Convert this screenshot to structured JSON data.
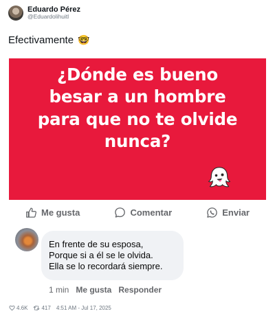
{
  "author": {
    "name": "Eduardo Pérez",
    "handle": "@Eduardolihuitl"
  },
  "tweet": {
    "text": "Efectivamente",
    "emoji": "🤓"
  },
  "post": {
    "lines": [
      "¿Dónde es bueno",
      "besar a un hombre",
      "para que no te olvide",
      "nunca?"
    ],
    "colors": {
      "background": "#e8193c",
      "text": "#ffffff"
    },
    "sticker": "ghost-sticker"
  },
  "actions": {
    "like": "Me gusta",
    "comment": "Comentar",
    "send": "Enviar"
  },
  "comment": {
    "lines": [
      "En frente de su esposa,",
      "Porque si a él se le olvida.",
      "Ella se lo recordará siempre."
    ],
    "time": "1 min",
    "like": "Me gusta",
    "reply": "Responder"
  },
  "footer": {
    "likes": "4.6K",
    "retweets": "417",
    "timestamp": "4:51 AM - Jul 17, 2025"
  }
}
